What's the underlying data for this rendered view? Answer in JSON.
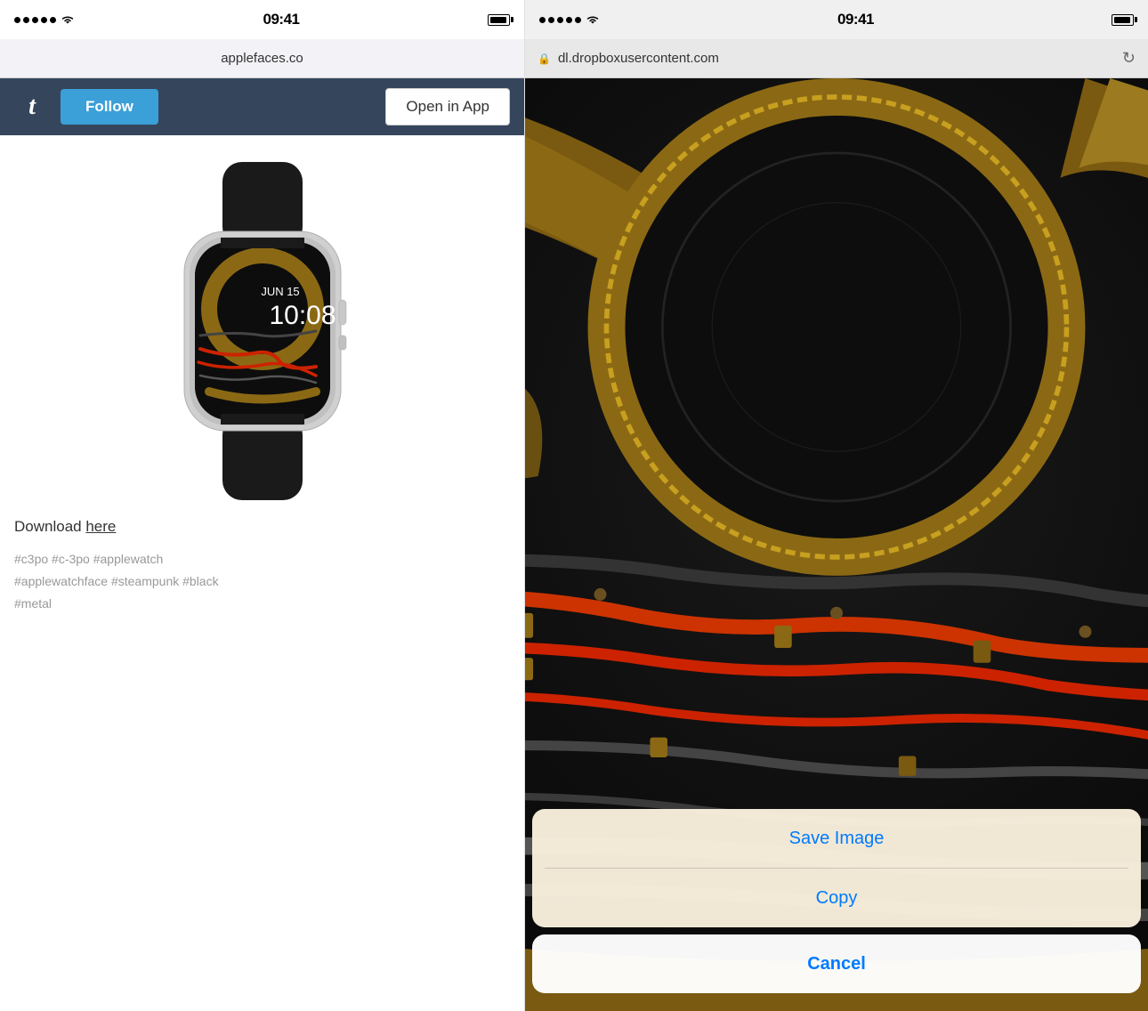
{
  "left": {
    "statusBar": {
      "time": "09:41",
      "url": "applefaces.co"
    },
    "header": {
      "followLabel": "Follow",
      "openInAppLabel": "Open in App"
    },
    "watch": {
      "date": "JUN 15",
      "time": "10:08"
    },
    "download": {
      "text": "Download ",
      "linkText": "here"
    },
    "tags": "#c3po  #c-3po  #applewatch\n#applewatchface  #steampunk  #black\n#metal"
  },
  "right": {
    "statusBar": {
      "time": "09:41"
    },
    "urlBar": {
      "url": "dl.dropboxusercontent.com",
      "secure": true
    },
    "actionSheet": {
      "saveImageLabel": "Save Image",
      "copyLabel": "Copy",
      "cancelLabel": "Cancel"
    }
  }
}
